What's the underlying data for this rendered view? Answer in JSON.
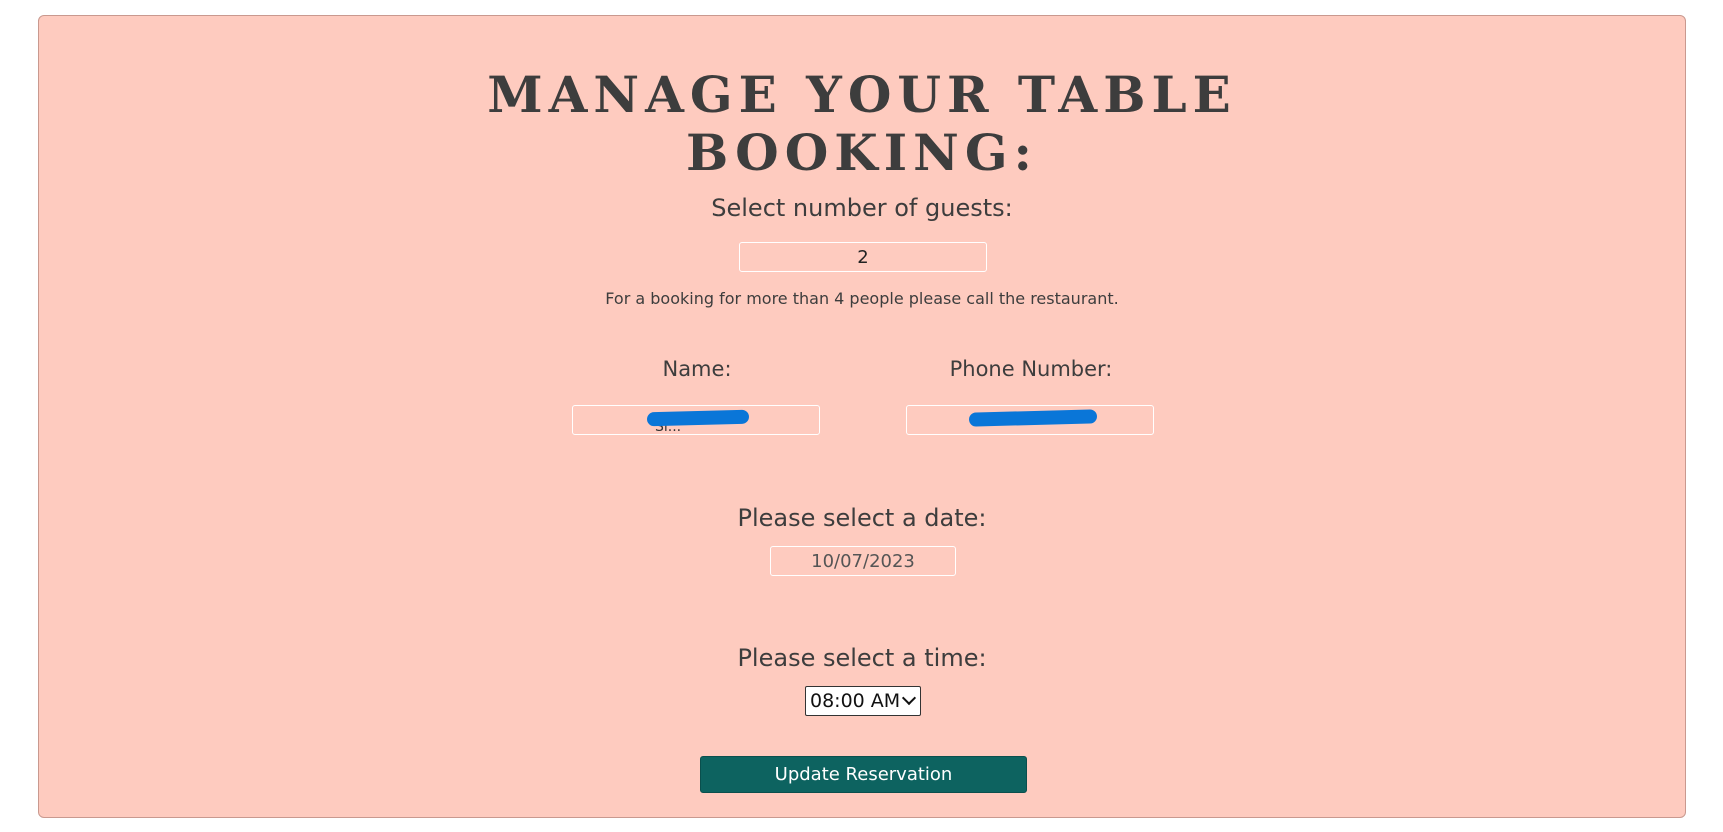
{
  "booking": {
    "title_line1": "MANAGE YOUR TABLE",
    "title_line2": "BOOKING:",
    "guests_label": "Select number of guests:",
    "guests_value": "2",
    "guests_note": "For a booking for more than 4 people please call the restaurant.",
    "name_label": "Name:",
    "phone_label": "Phone Number:",
    "date_label": "Please select a date:",
    "date_value": "10/07/2023",
    "time_label": "Please select a time:",
    "time_value": "08:00 AM",
    "submit_label": "Update Reservation"
  },
  "colors": {
    "panel_bg": "#fecbbf",
    "button_bg": "#0d6360",
    "redaction": "#0a76d8"
  }
}
